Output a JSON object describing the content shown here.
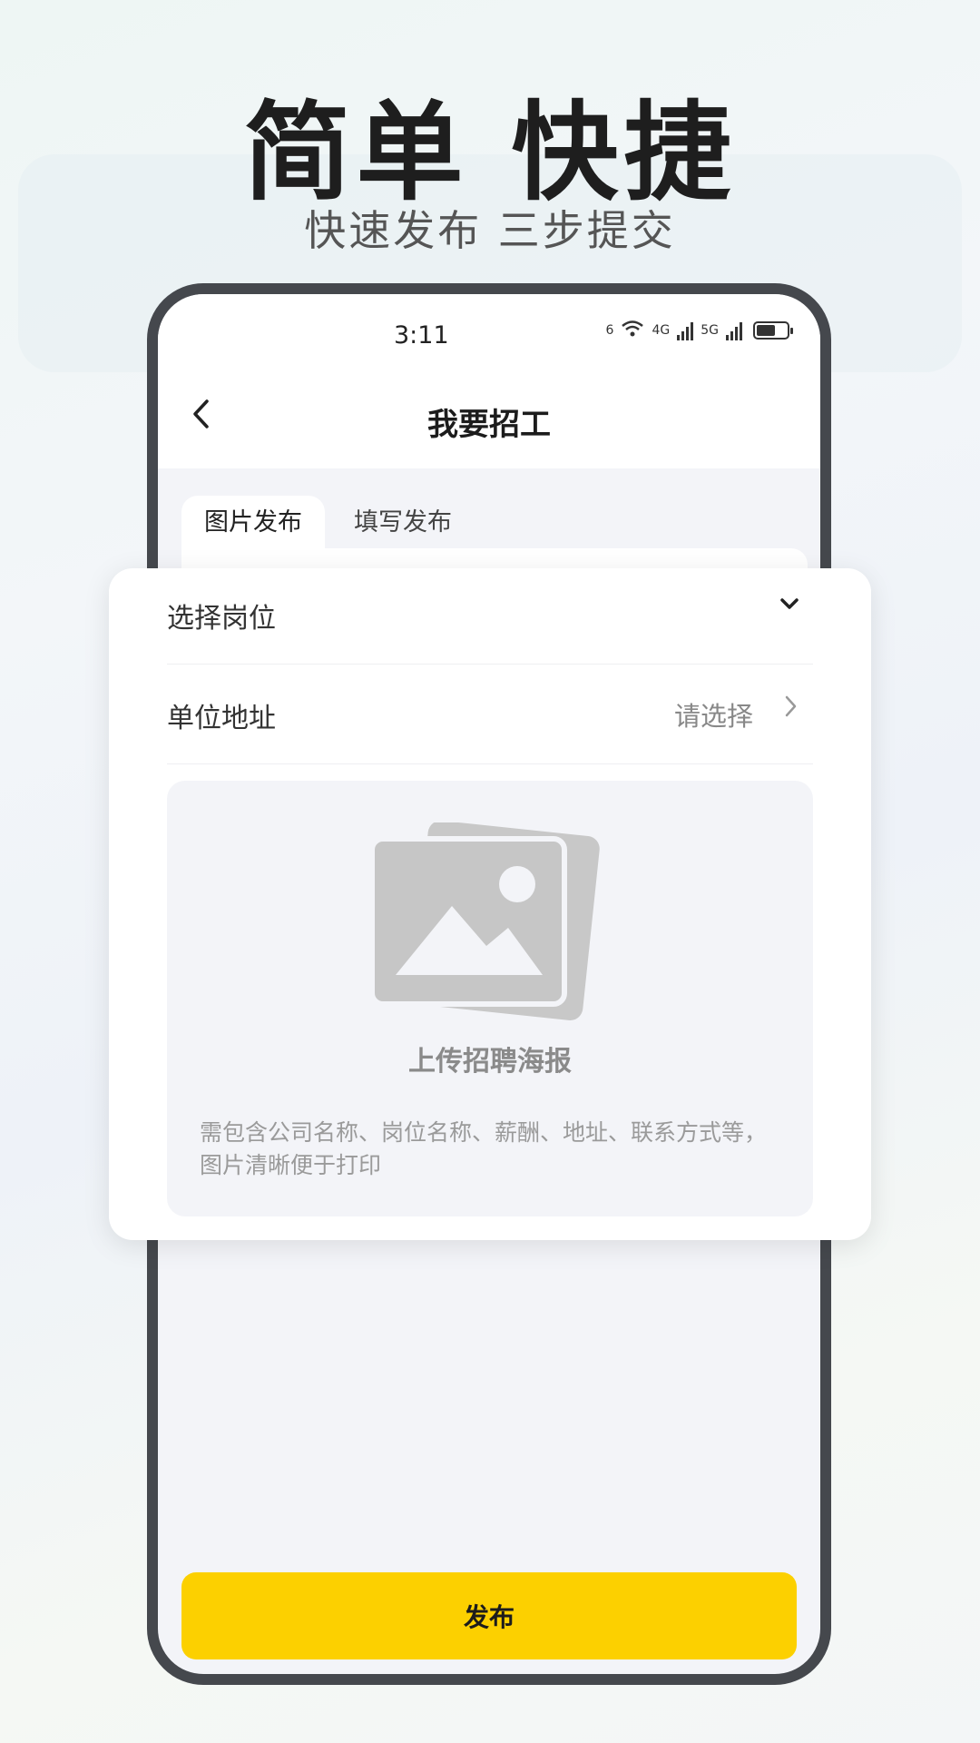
{
  "promo": {
    "headline": "简单 快捷",
    "subline": "快速发布 三步提交"
  },
  "status_bar": {
    "time": "3:11",
    "network_1": "6",
    "network_2": "4G",
    "network_3": "5G"
  },
  "nav": {
    "back_icon": "chevron-left-icon",
    "title": "我要招工"
  },
  "tabs": [
    {
      "label": "图片发布",
      "active": true
    },
    {
      "label": "填写发布",
      "active": false
    }
  ],
  "form": {
    "position_label": "选择岗位",
    "address_label": "单位地址",
    "address_value": "请选择"
  },
  "upload": {
    "title": "上传招聘海报",
    "hint": "需包含公司名称、岗位名称、薪酬、地址、联系方式等，图片清晰便于打印"
  },
  "actions": {
    "publish_label": "发布"
  },
  "colors": {
    "accent": "#fcd000",
    "phone_frame": "#45484d",
    "placeholder_gray": "#c8c8c8"
  }
}
